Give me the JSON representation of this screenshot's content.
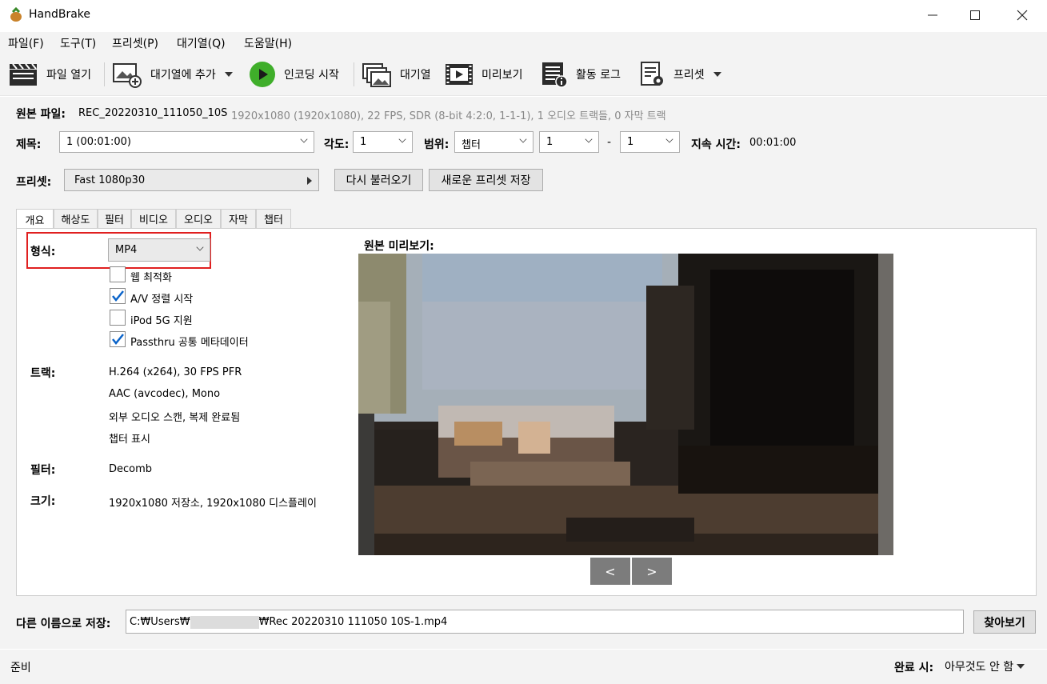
{
  "window": {
    "title": "HandBrake"
  },
  "menu": [
    "파일(F)",
    "도구(T)",
    "프리셋(P)",
    "대기열(Q)",
    "도움말(H)"
  ],
  "toolbar": {
    "open": "파일 열기",
    "add_queue": "대기열에 추가",
    "start": "인코딩 시작",
    "queue": "대기열",
    "preview": "미리보기",
    "activity": "활동 로그",
    "presets": "프리셋"
  },
  "source": {
    "label": "원본 파일:",
    "name": "REC_20220310_111050_10S",
    "info": "1920x1080 (1920x1080), 22 FPS, SDR (8-bit 4:2:0, 1-1-1), 1 오디오 트랙들, 0 자막 트랙"
  },
  "title_row": {
    "title_label": "제목:",
    "title_value": "1  (00:01:00)",
    "angle_label": "각도:",
    "angle_value": "1",
    "range_label": "범위:",
    "range_type": "챕터",
    "range_start": "1",
    "range_dash": "-",
    "range_end": "1",
    "duration_label": "지속 시간:",
    "duration_value": "00:01:00"
  },
  "preset_row": {
    "label": "프리셋:",
    "value": "Fast 1080p30",
    "reload": "다시 불러오기",
    "save_new": "새로운 프리셋 저장"
  },
  "tabs": [
    "개요",
    "해상도",
    "필터",
    "비디오",
    "오디오",
    "자막",
    "챕터"
  ],
  "summary": {
    "format_label": "형식:",
    "format_value": "MP4",
    "options": [
      {
        "label": "웹 최적화",
        "checked": false
      },
      {
        "label": "A/V 정렬 시작",
        "checked": true
      },
      {
        "label": "iPod 5G 지원",
        "checked": false
      },
      {
        "label": "Passthru 공통 메타데이터",
        "checked": true
      }
    ],
    "tracks_label": "트랙:",
    "tracks": [
      "H.264 (x264), 30 FPS PFR",
      "AAC (avcodec), Mono",
      "외부 오디오 스캔, 복제 완료됨",
      "챕터 표시"
    ],
    "filters_label": "필터:",
    "filters_value": "Decomb",
    "size_label": "크기:",
    "size_value": "1920x1080 저장소, 1920x1080 디스플레이",
    "preview_label": "원본 미리보기:",
    "prev_btn": "<",
    "next_btn": ">"
  },
  "save": {
    "label": "다른 이름으로 저장:",
    "path_prefix": "C:₩Users₩",
    "path_suffix": "₩Rec 20220310 111050 10S-1.mp4",
    "browse": "찾아보기"
  },
  "status": {
    "ready": "준비",
    "when_done_label": "완료 시:",
    "when_done_value": "아무것도 안 함"
  },
  "colors": {
    "highlight_box": "#e02020",
    "accent_check": "#0a63c9",
    "play_green": "#3fae2a"
  }
}
